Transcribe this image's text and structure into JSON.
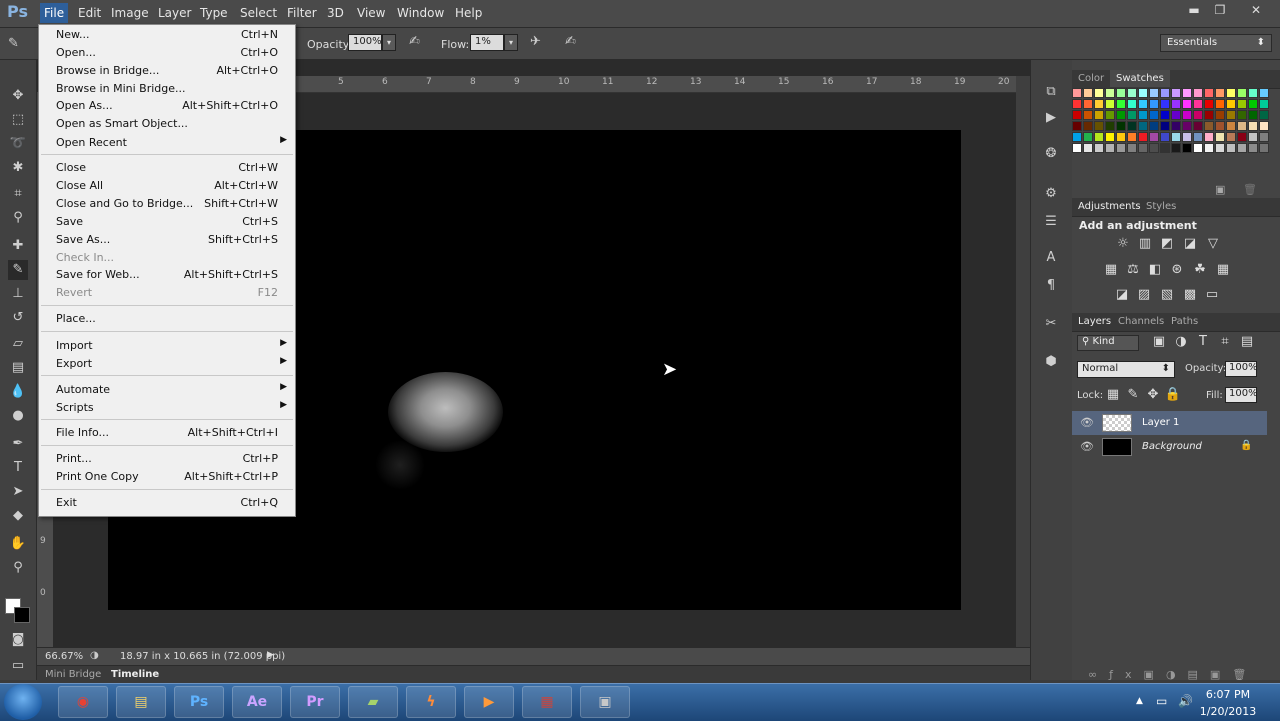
{
  "app": {
    "logo": "Ps"
  },
  "menubar": {
    "items": [
      "File",
      "Edit",
      "Image",
      "Layer",
      "Type",
      "Select",
      "Filter",
      "3D",
      "View",
      "Window",
      "Help"
    ]
  },
  "window_controls": {
    "minimize": "▬",
    "restore": "❐",
    "close": "✕"
  },
  "options": {
    "opacity_label": "Opacity:",
    "opacity_value": "100%",
    "flow_label": "Flow:",
    "flow_value": "1%",
    "workspace": "Essentials"
  },
  "file_menu": {
    "items": [
      {
        "label": "New...",
        "shortcut": "Ctrl+N"
      },
      {
        "label": "Open...",
        "shortcut": "Ctrl+O"
      },
      {
        "label": "Browse in Bridge...",
        "shortcut": "Alt+Ctrl+O"
      },
      {
        "label": "Browse in Mini Bridge...",
        "shortcut": ""
      },
      {
        "label": "Open As...",
        "shortcut": "Alt+Shift+Ctrl+O"
      },
      {
        "label": "Open as Smart Object...",
        "shortcut": ""
      },
      {
        "label": "Open Recent",
        "shortcut": ""
      },
      {
        "label": "Close",
        "shortcut": "Ctrl+W"
      },
      {
        "label": "Close All",
        "shortcut": "Alt+Ctrl+W"
      },
      {
        "label": "Close and Go to Bridge...",
        "shortcut": "Shift+Ctrl+W"
      },
      {
        "label": "Save",
        "shortcut": "Ctrl+S"
      },
      {
        "label": "Save As...",
        "shortcut": "Shift+Ctrl+S"
      },
      {
        "label": "Check In...",
        "shortcut": ""
      },
      {
        "label": "Save for Web...",
        "shortcut": "Alt+Shift+Ctrl+S"
      },
      {
        "label": "Revert",
        "shortcut": "F12"
      },
      {
        "label": "Place...",
        "shortcut": ""
      },
      {
        "label": "Import",
        "shortcut": ""
      },
      {
        "label": "Export",
        "shortcut": ""
      },
      {
        "label": "Automate",
        "shortcut": ""
      },
      {
        "label": "Scripts",
        "shortcut": ""
      },
      {
        "label": "File Info...",
        "shortcut": "Alt+Shift+Ctrl+I"
      },
      {
        "label": "Print...",
        "shortcut": "Ctrl+P"
      },
      {
        "label": "Print One Copy",
        "shortcut": "Alt+Shift+Ctrl+P"
      },
      {
        "label": "Exit",
        "shortcut": "Ctrl+Q"
      }
    ]
  },
  "rulers": {
    "top": [
      "5",
      "6",
      "7",
      "8",
      "9",
      "10",
      "11",
      "12",
      "13",
      "14",
      "15",
      "16",
      "17",
      "18",
      "19",
      "20"
    ],
    "left": [
      "9",
      "0"
    ]
  },
  "status": {
    "zoom": "66.67%",
    "doc_info": "18.97 in x 10.665 in (72.009 ppi)"
  },
  "bottom_tabs": [
    "Mini Bridge",
    "Timeline"
  ],
  "panels": {
    "color_tabs": [
      "Color",
      "Swatches"
    ],
    "adjust_tabs": [
      "Adjustments",
      "Styles"
    ],
    "adjust_title": "Add an adjustment",
    "layers_tabs": [
      "Layers",
      "Channels",
      "Paths"
    ],
    "kind": "Kind",
    "blend_mode": "Normal",
    "opacity_label": "Opacity:",
    "opacity_value": "100%",
    "lock_label": "Lock:",
    "fill_label": "Fill:",
    "fill_value": "100%",
    "layers": [
      {
        "name": "Layer 1"
      },
      {
        "name": "Background"
      }
    ]
  },
  "swatch_colors": [
    "#ff9999",
    "#ffcc99",
    "#ffff99",
    "#ccff99",
    "#99ff99",
    "#99ffcc",
    "#99ffff",
    "#99ccff",
    "#9999ff",
    "#cc99ff",
    "#ff99ff",
    "#ff99cc",
    "#ff6666",
    "#ff9966",
    "#ffff66",
    "#99ff66",
    "#66ffcc",
    "#66ccff",
    "#ff3333",
    "#ff6633",
    "#ffcc33",
    "#ccff33",
    "#33ff33",
    "#33ffcc",
    "#33ccff",
    "#3399ff",
    "#3333ff",
    "#9933ff",
    "#ff33ff",
    "#ff3399",
    "#e60000",
    "#ff6600",
    "#ffcc00",
    "#99cc00",
    "#00cc00",
    "#00cc99",
    "#cc0000",
    "#cc5200",
    "#cca300",
    "#669900",
    "#009900",
    "#009966",
    "#0099cc",
    "#0066cc",
    "#0000cc",
    "#6600cc",
    "#cc00cc",
    "#cc0066",
    "#990000",
    "#993d00",
    "#997a00",
    "#336600",
    "#006600",
    "#006644",
    "#660000",
    "#662900",
    "#665200",
    "#1f3d00",
    "#003300",
    "#003322",
    "#006680",
    "#003d80",
    "#000080",
    "#330066",
    "#660066",
    "#660033",
    "#8b5a2b",
    "#a0522d",
    "#cd853f",
    "#deb887",
    "#f5deb3",
    "#ffe4c4",
    "#00a2e8",
    "#22b14c",
    "#b5e61d",
    "#fff200",
    "#ffc90e",
    "#ff7f27",
    "#ed1c24",
    "#a349a4",
    "#3f48cc",
    "#99d9ea",
    "#c8bfe7",
    "#7092be",
    "#ffaec9",
    "#efe4b0",
    "#b97a57",
    "#880015",
    "#c3c3c3",
    "#7f7f7f",
    "#ffffff",
    "#e6e6e6",
    "#cccccc",
    "#b3b3b3",
    "#999999",
    "#808080",
    "#666666",
    "#4d4d4d",
    "#333333",
    "#1a1a1a",
    "#000000",
    "#ffffff",
    "#f2f2f2",
    "#d9d9d9",
    "#bfbfbf",
    "#a6a6a6",
    "#8c8c8c",
    "#737373"
  ],
  "taskbar": {
    "apps": [
      {
        "name": "chrome",
        "glyph": "◉",
        "color": "#e84133"
      },
      {
        "name": "explorer",
        "glyph": "▤",
        "color": "#f3d36b"
      },
      {
        "name": "photoshop",
        "glyph": "Ps",
        "color": "#5fb3ff"
      },
      {
        "name": "after-effects",
        "glyph": "Ae",
        "color": "#c9a4ff"
      },
      {
        "name": "premiere",
        "glyph": "Pr",
        "color": "#d29cff"
      },
      {
        "name": "notes",
        "glyph": "▰",
        "color": "#a6d36b"
      },
      {
        "name": "flash",
        "glyph": "ϟ",
        "color": "#ff8c3a"
      },
      {
        "name": "media",
        "glyph": "▶",
        "color": "#ff9a3a"
      },
      {
        "name": "winrar",
        "glyph": "▦",
        "color": "#c7463f"
      },
      {
        "name": "camera",
        "glyph": "▣",
        "color": "#c8c8c8"
      }
    ],
    "time": "6:07 PM",
    "date": "1/20/2013"
  }
}
